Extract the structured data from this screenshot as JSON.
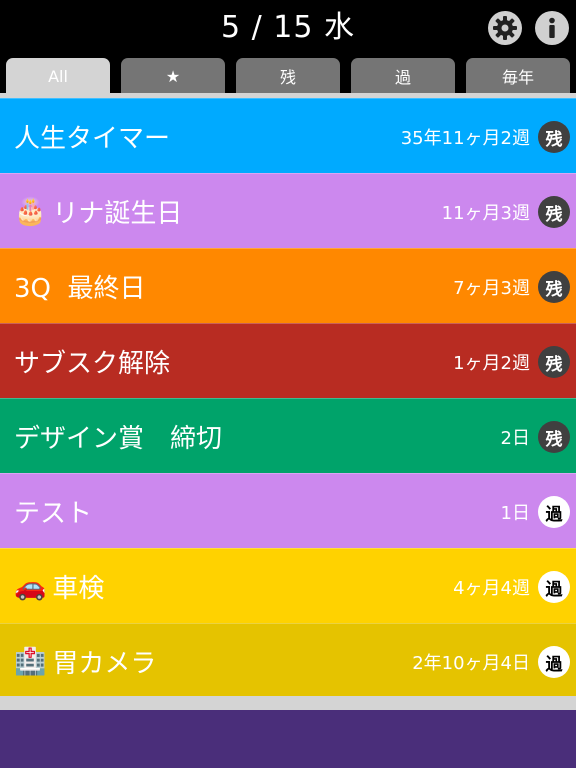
{
  "header": {
    "date": "5 / 15 水",
    "settings_icon": "gear-icon",
    "info_icon": "info-icon"
  },
  "tabs": [
    {
      "label": "All",
      "active": true
    },
    {
      "label": "★",
      "active": false
    },
    {
      "label": "残",
      "active": false
    },
    {
      "label": "過",
      "active": false
    },
    {
      "label": "毎年",
      "active": false
    }
  ],
  "events": [
    {
      "title": "人生タイマー",
      "period": "35年11ヶ月2週",
      "badge": "残",
      "color": "#00aaff",
      "emoji": ""
    },
    {
      "title": "リナ誕生日",
      "period": "11ヶ月3週",
      "badge": "残",
      "color": "#cc88ee",
      "emoji": "🎂"
    },
    {
      "title": "3Q  最終日",
      "period": "7ヶ月3週",
      "badge": "残",
      "color": "#ff8800",
      "emoji": ""
    },
    {
      "title": "サブスク解除",
      "period": "1ヶ月2週",
      "badge": "残",
      "color": "#b82c22",
      "emoji": ""
    },
    {
      "title": "デザイン賞　締切",
      "period": "2日",
      "badge": "残",
      "color": "#00a36a",
      "emoji": ""
    },
    {
      "title": "テスト",
      "period": "1日",
      "badge": "過",
      "color": "#cc88ee",
      "emoji": ""
    },
    {
      "title": "車検",
      "period": "4ヶ月4週",
      "badge": "過",
      "color": "#ffd200",
      "emoji": "🚗"
    },
    {
      "title": "胃カメラ",
      "period": "2年10ヶ月4日",
      "badge": "過",
      "color": "#e5c300",
      "emoji": "🏥"
    }
  ]
}
